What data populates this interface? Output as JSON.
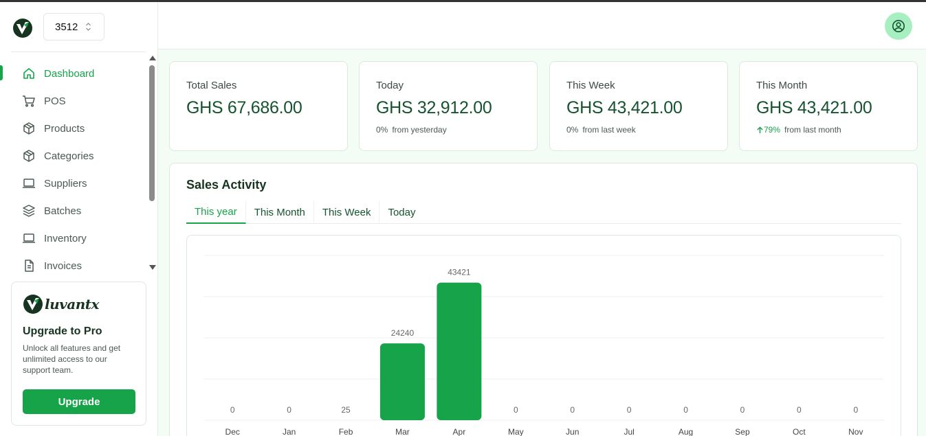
{
  "store": {
    "selected": "3512"
  },
  "sidebar": {
    "items": [
      {
        "label": "Dashboard",
        "icon": "home-icon",
        "active": true
      },
      {
        "label": "POS",
        "icon": "cart-icon",
        "active": false
      },
      {
        "label": "Products",
        "icon": "box-icon",
        "active": false
      },
      {
        "label": "Categories",
        "icon": "box-icon",
        "active": false
      },
      {
        "label": "Suppliers",
        "icon": "laptop-icon",
        "active": false
      },
      {
        "label": "Batches",
        "icon": "layers-icon",
        "active": false
      },
      {
        "label": "Inventory",
        "icon": "laptop-icon",
        "active": false
      },
      {
        "label": "Invoices",
        "icon": "document-icon",
        "active": false
      }
    ]
  },
  "promo": {
    "brand": "luvantx",
    "title": "Upgrade to Pro",
    "text": "Unlock all features and get unlimited access to our support team.",
    "button": "Upgrade"
  },
  "stats": [
    {
      "label": "Total Sales",
      "value": "GHS 67,686.00",
      "change": "",
      "change_text": "",
      "trend": "none"
    },
    {
      "label": "Today",
      "value": "GHS 32,912.00",
      "change": "0%",
      "change_text": "from yesterday",
      "trend": "flat"
    },
    {
      "label": "This Week",
      "value": "GHS 43,421.00",
      "change": "0%",
      "change_text": "from last week",
      "trend": "flat"
    },
    {
      "label": "This Month",
      "value": "GHS 43,421.00",
      "change": "79%",
      "change_text": "from last month",
      "trend": "up"
    }
  ],
  "activity": {
    "title": "Sales Activity",
    "tabs": [
      {
        "label": "This year",
        "active": true
      },
      {
        "label": "This Month",
        "active": false
      },
      {
        "label": "This Week",
        "active": false
      },
      {
        "label": "Today",
        "active": false
      }
    ]
  },
  "colors": {
    "accent": "#16a34a",
    "dark_green": "#14532d",
    "avatar_bg": "#a7efc1"
  },
  "chart_data": {
    "type": "bar",
    "categories": [
      "Dec",
      "Jan",
      "Feb",
      "Mar",
      "Apr",
      "May",
      "Jun",
      "Jul",
      "Aug",
      "Sep",
      "Oct",
      "Nov"
    ],
    "values": [
      0,
      0,
      25,
      24240,
      43421,
      0,
      0,
      0,
      0,
      0,
      0,
      0
    ],
    "ylim": [
      0,
      52000
    ],
    "grid": true,
    "data_labels": true,
    "color": "#16a34a"
  }
}
